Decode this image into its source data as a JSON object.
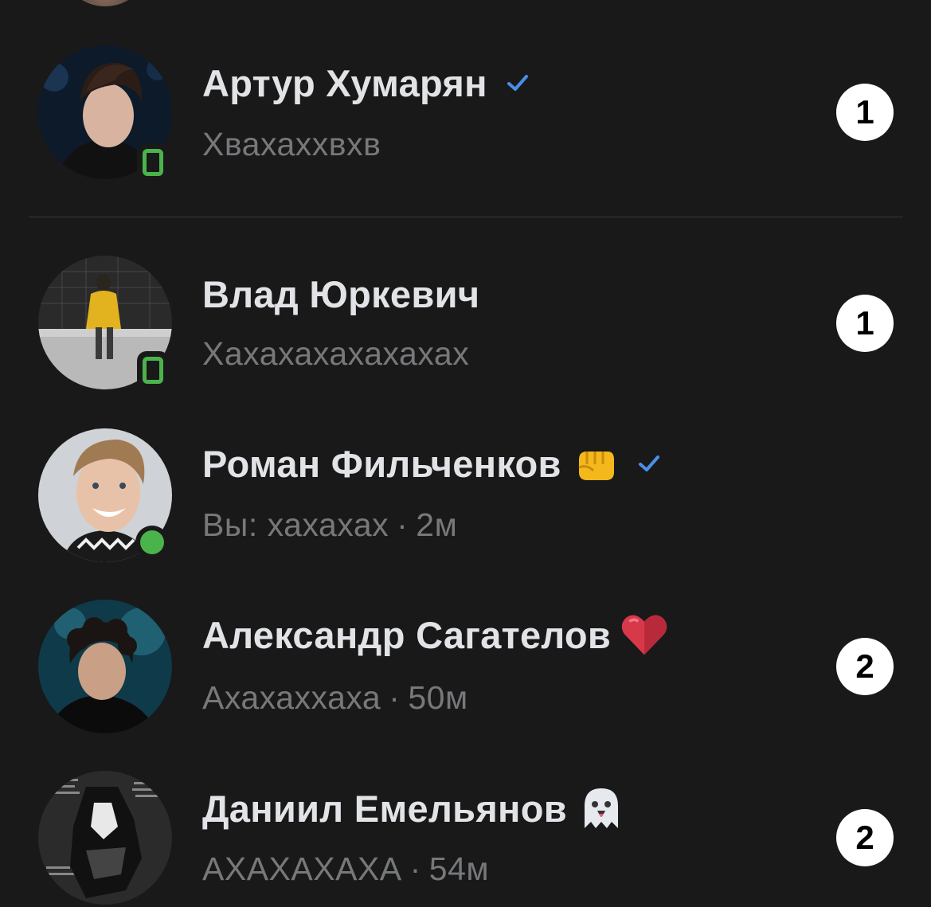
{
  "colors": {
    "background": "#19191a",
    "name_text": "#e1e3e6",
    "preview_text": "#76787a",
    "online_green": "#4bb34b",
    "verified_blue": "#4a8ee8",
    "badge_bg": "#ffffff",
    "badge_text": "#000000"
  },
  "chats": [
    {
      "name": "Артур Хумарян",
      "verified": true,
      "emoji": "",
      "preview": "Хвахаххвхв",
      "separator": "",
      "time": "",
      "unread": "1",
      "presence": "mobile"
    },
    {
      "name": "Влад Юркевич",
      "verified": false,
      "emoji": "",
      "preview": "Хахахахахахахах",
      "separator": "",
      "time": "",
      "unread": "1",
      "presence": "mobile"
    },
    {
      "name": "Роман Фильченков",
      "verified": true,
      "emoji": "fist-emoji",
      "preview": "Вы: хахахах",
      "separator": "·",
      "time": "2м",
      "unread": "",
      "presence": "online"
    },
    {
      "name": "Александр Сагателов",
      "verified": false,
      "emoji": "heart-emoji",
      "preview": "Ахахаххаха",
      "separator": "·",
      "time": "50м",
      "unread": "2",
      "presence": "none"
    },
    {
      "name": "Даниил Емельянов",
      "verified": false,
      "emoji": "ghost-emoji",
      "preview": "АХАХАХАХА",
      "separator": "·",
      "time": "54м",
      "unread": "2",
      "presence": "none"
    }
  ]
}
